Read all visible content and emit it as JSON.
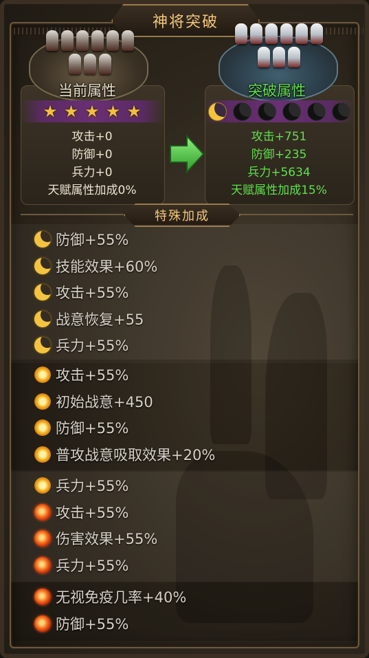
{
  "title": "神将突破",
  "current": {
    "label": "当前属性",
    "stars": 5,
    "stats": [
      "攻击+0",
      "防御+0",
      "兵力+0",
      "天赋属性加成0%"
    ]
  },
  "breakthrough": {
    "label": "突破属性",
    "moons_total": 6,
    "moons_lit": 1,
    "stats": [
      "攻击+751",
      "防御+235",
      "兵力+5634",
      "天赋属性加成15%"
    ]
  },
  "special_header": "特殊加成",
  "bonus_groups": [
    {
      "rows": [
        {
          "icon": "moon-icon",
          "text": "防御+55%"
        },
        {
          "icon": "moon-icon",
          "text": "技能效果+60%"
        },
        {
          "icon": "moon-icon",
          "text": "攻击+55%"
        },
        {
          "icon": "moon-icon",
          "text": "战意恢复+55"
        },
        {
          "icon": "moon-icon",
          "text": "兵力+55%"
        }
      ]
    },
    {
      "rows": [
        {
          "icon": "sun-icon",
          "text": "攻击+55%"
        },
        {
          "icon": "sun-icon",
          "text": "初始战意+450"
        },
        {
          "icon": "sun-icon",
          "text": "防御+55%"
        },
        {
          "icon": "sun-icon",
          "text": "普攻战意吸取效果+20%"
        }
      ]
    },
    {
      "rows": [
        {
          "icon": "sun-icon",
          "text": "兵力+55%"
        },
        {
          "icon": "fire-icon",
          "text": "攻击+55%"
        },
        {
          "icon": "fire-icon",
          "text": "伤害效果+55%"
        },
        {
          "icon": "fire-icon",
          "text": "兵力+55%"
        }
      ]
    },
    {
      "rows": [
        {
          "icon": "fire-icon",
          "text": "无视免疫几率+40%"
        },
        {
          "icon": "fire-icon",
          "text": "防御+55%"
        }
      ]
    }
  ],
  "colors": {
    "gold": "#f3c87a",
    "green": "#5fe04c",
    "text": "#d8d2c8"
  }
}
